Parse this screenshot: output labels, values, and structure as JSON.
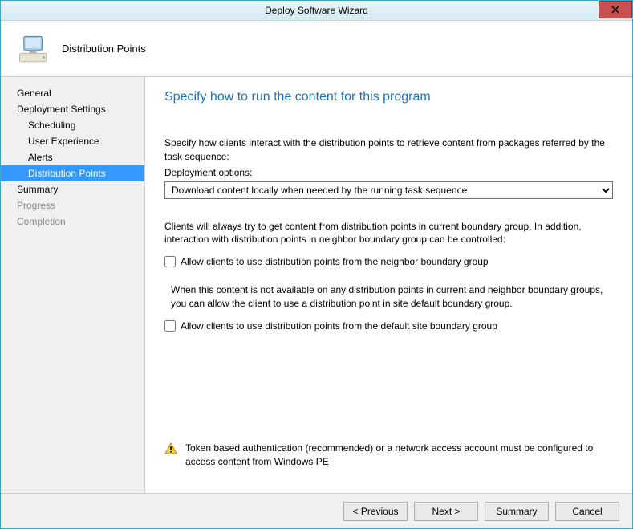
{
  "window": {
    "title": "Deploy Software Wizard"
  },
  "header": {
    "title": "Distribution Points"
  },
  "sidebar": {
    "items": [
      {
        "label": "General",
        "level": "top"
      },
      {
        "label": "Deployment Settings",
        "level": "top"
      },
      {
        "label": "Scheduling",
        "level": "sub"
      },
      {
        "label": "User Experience",
        "level": "sub"
      },
      {
        "label": "Alerts",
        "level": "sub"
      },
      {
        "label": "Distribution Points",
        "level": "sub",
        "selected": true
      },
      {
        "label": "Summary",
        "level": "top"
      },
      {
        "label": "Progress",
        "level": "top",
        "disabled": true
      },
      {
        "label": "Completion",
        "level": "top",
        "disabled": true
      }
    ]
  },
  "content": {
    "heading": "Specify how to run the content for this program",
    "intro": "Specify how clients interact with the distribution points to retrieve content from packages referred by the task sequence:",
    "deploy_label": "Deployment options:",
    "deploy_value": "Download content locally when needed by the running task sequence",
    "section2": "Clients will always try to get content from distribution points in current boundary group. In addition, interaction with distribution points in neighbor boundary group can be controlled:",
    "chk1": "Allow clients to use distribution points from the neighbor boundary group",
    "section3": "When this content is not available on any distribution points in current and neighbor boundary groups, you can allow the client to use a distribution point in site default boundary group.",
    "chk2": "Allow clients to use distribution points from the default site boundary group",
    "warning": "Token based authentication (recommended) or a network access account must be configured to access content from Windows PE"
  },
  "footer": {
    "previous": "< Previous",
    "next": "Next >",
    "summary": "Summary",
    "cancel": "Cancel"
  }
}
